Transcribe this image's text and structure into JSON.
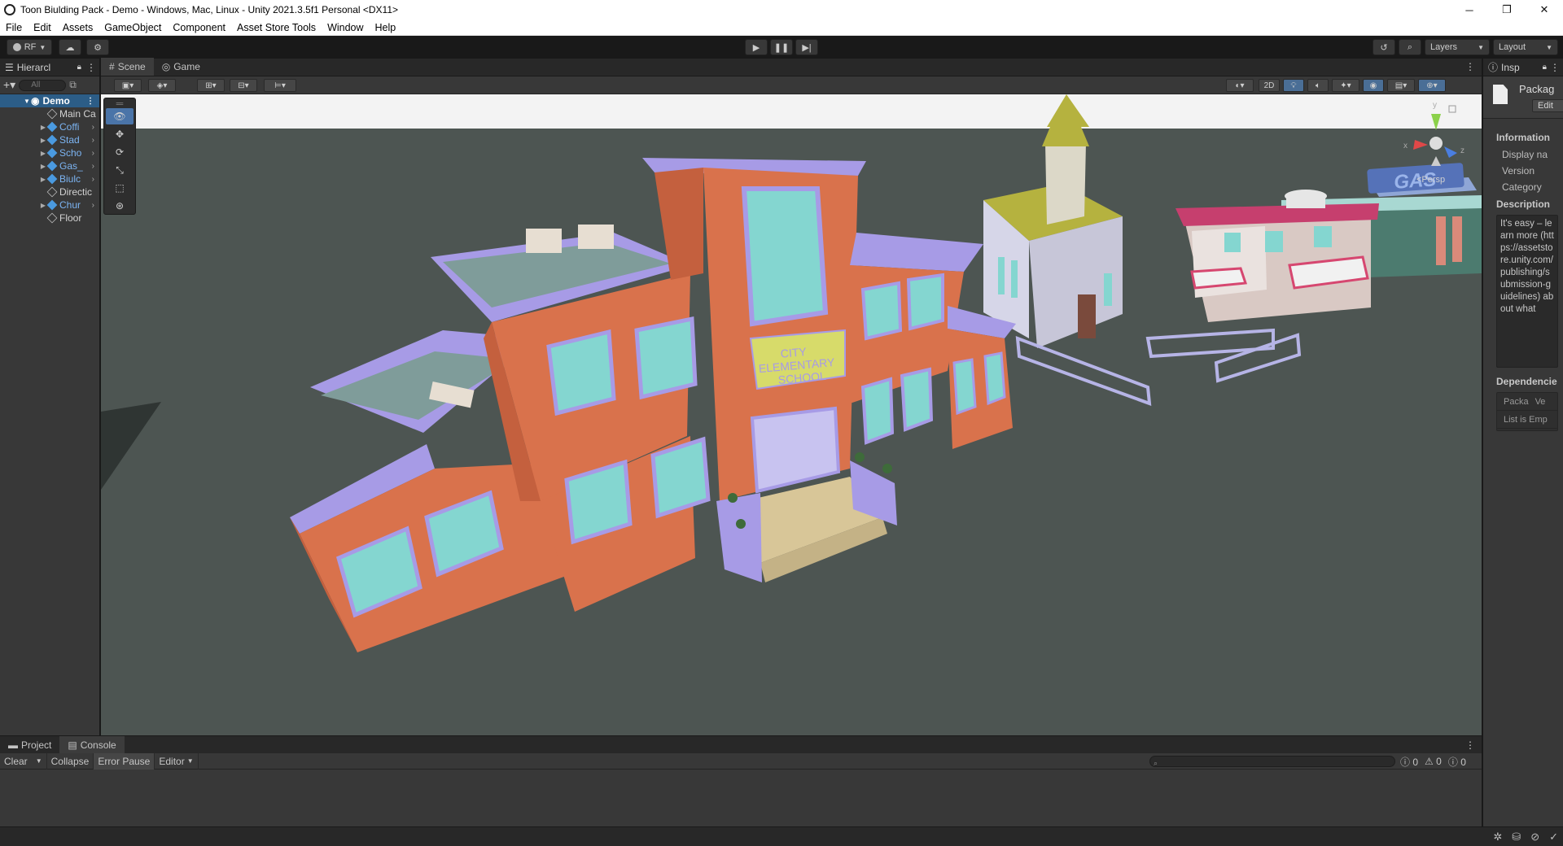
{
  "window": {
    "title": "Toon Biulding Pack - Demo - Windows, Mac, Linux - Unity 2021.3.5f1 Personal <DX11>",
    "minimize": "─",
    "restore": "❐",
    "close": "✕"
  },
  "menu": [
    "File",
    "Edit",
    "Assets",
    "GameObject",
    "Component",
    "Asset Store Tools",
    "Window",
    "Help"
  ],
  "toolbar": {
    "account": "RF",
    "layers": "Layers",
    "layout": "Layout"
  },
  "hierarchy": {
    "tab": "Hierarcl",
    "search_placeholder": "All",
    "root": "Demo",
    "items": [
      {
        "label": "Main Ca",
        "prefab": false,
        "expandable": false
      },
      {
        "label": "Coffi",
        "prefab": true,
        "expandable": true
      },
      {
        "label": "Stad",
        "prefab": true,
        "expandable": true
      },
      {
        "label": "Scho",
        "prefab": true,
        "expandable": true
      },
      {
        "label": "Gas_",
        "prefab": true,
        "expandable": true
      },
      {
        "label": "Biulc",
        "prefab": true,
        "expandable": true
      },
      {
        "label": "Directic",
        "prefab": false,
        "expandable": false
      },
      {
        "label": "Chur",
        "prefab": true,
        "expandable": true
      },
      {
        "label": "Floor",
        "prefab": false,
        "expandable": false
      }
    ]
  },
  "scene": {
    "tabs": [
      "Scene",
      "Game"
    ],
    "mode_2d": "2D",
    "persp": "<Persp",
    "gizmo_axes": {
      "y": "y",
      "z": "z",
      "x": "x"
    },
    "sign_school": [
      "CITY",
      "ELEMENTARY",
      "SCHOOL"
    ],
    "sign_gas": "GAS"
  },
  "inspector": {
    "tab": "Insp",
    "header": "Packag",
    "edit_button": "Edit",
    "information": "Information",
    "fields": [
      "Display na",
      "Version",
      "Category"
    ],
    "description_label": "Description",
    "description_text": "It's easy – learn more (https://assetstore.unity.com/publishing/submission-guidelines) about what",
    "dependencies_label": "Dependencie",
    "dep_headers": [
      "Packa",
      "Ve"
    ],
    "dep_empty": "List is Emp"
  },
  "bottom": {
    "tabs": [
      "Project",
      "Console"
    ],
    "console_buttons": [
      "Clear",
      "Collapse",
      "Error Pause",
      "Editor"
    ],
    "counts": {
      "log": "0",
      "warn": "0",
      "error": "0"
    }
  },
  "colors": {
    "accent": "#2c5d87",
    "prefab_blue": "#7cb4f2",
    "sky": "#f2f2f2",
    "ground": "#4d5552",
    "brick": "#d9724c",
    "trim": "#a79be6",
    "glass": "#84d6d0"
  }
}
